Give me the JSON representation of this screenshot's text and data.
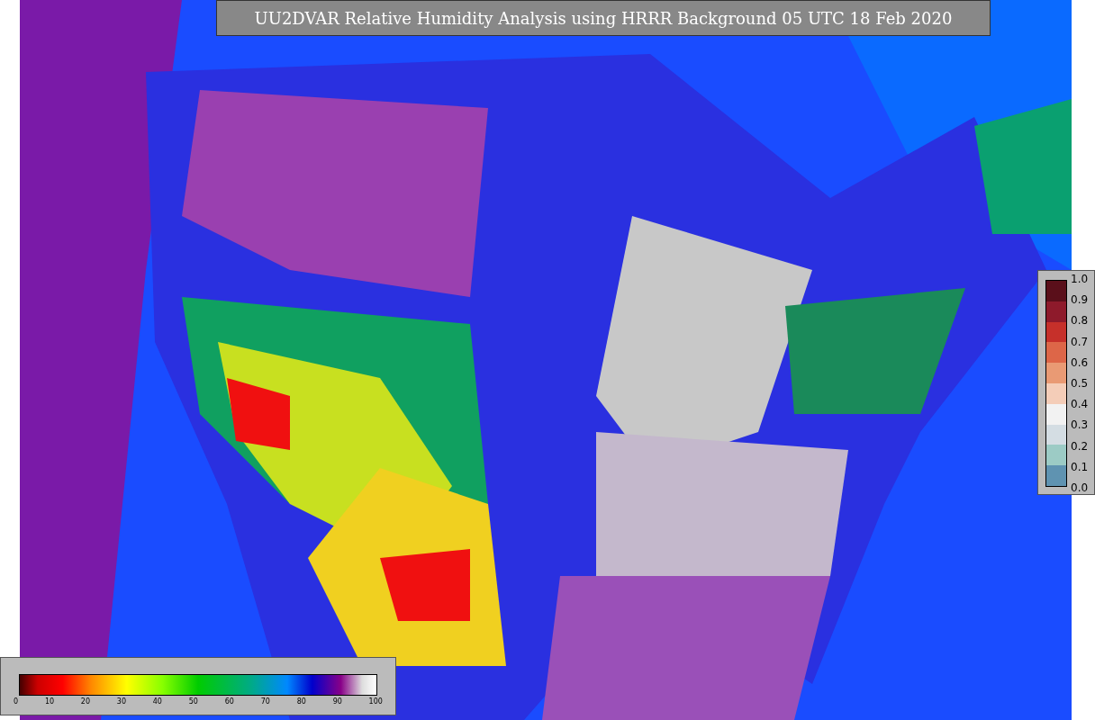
{
  "title": "UU2DVAR Relative Humidity Analysis using HRRR Background 05 UTC 18 Feb 2020",
  "increment_legend": {
    "ticks": [
      "1.0",
      "0.9",
      "0.8",
      "0.7",
      "0.6",
      "0.5",
      "0.4",
      "0.3",
      "0.2",
      "0.1",
      "0.0"
    ]
  },
  "humidity_legend": {
    "ticks": [
      "0",
      "10",
      "20",
      "30",
      "40",
      "50",
      "60",
      "70",
      "80",
      "90",
      "100"
    ]
  }
}
